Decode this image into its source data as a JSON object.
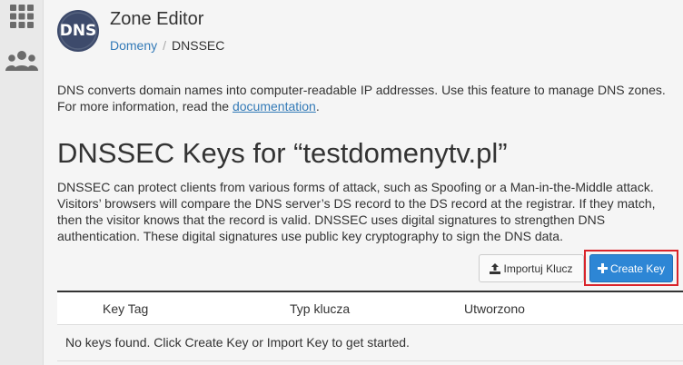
{
  "sidebar": {
    "items": [
      {
        "icon": "grid-icon"
      },
      {
        "icon": "users-icon"
      }
    ]
  },
  "header": {
    "logo_text": "DNS",
    "title": "Zone Editor",
    "breadcrumb": {
      "parent": "Domeny",
      "separator": "/",
      "current": "DNSSEC"
    }
  },
  "intro": {
    "text_before": "DNS converts domain names into computer-readable IP addresses. Use this feature to manage DNS zones. For more information, read the ",
    "link": "documentation",
    "text_after": "."
  },
  "page": {
    "title": "DNSSEC Keys for “testdomenytv.pl”",
    "description": "DNSSEC can protect clients from various forms of attack, such as Spoofing or a Man-in-the-Middle attack. Visitors’ browsers will compare the DNS server’s DS record to the DS record at the registrar. If they match, then the visitor knows that the record is valid. DNSSEC uses digital signatures to strengthen DNS authentication. These digital signatures use public key cryptography to sign the DNS data."
  },
  "actions": {
    "import_label": "Importuj Klucz",
    "create_label": "Create Key"
  },
  "table": {
    "columns": [
      "Key Tag",
      "Typ klucza",
      "Utworzono"
    ],
    "empty_message": "No keys found. Click Create Key or Import Key to get started."
  },
  "colors": {
    "accent": "#2d86d5",
    "link": "#337ab7",
    "highlight": "#d9232a",
    "logo_bg": "#3d4a6b"
  }
}
